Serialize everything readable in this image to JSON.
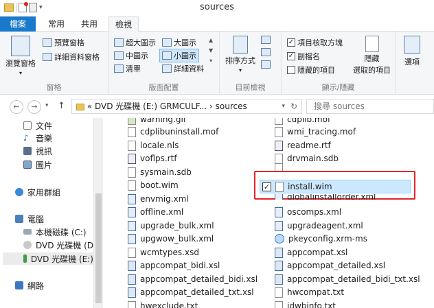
{
  "window": {
    "title": "sources"
  },
  "ribbon_tabs": [
    {
      "label": "檔案"
    },
    {
      "label": "常用"
    },
    {
      "label": "共用"
    },
    {
      "label": "檢視"
    }
  ],
  "ribbon": {
    "panes": {
      "label": "窗格",
      "nav_pane": "瀏覽窗格",
      "preview_pane": "預覽窗格",
      "details_pane": "詳細資料窗格"
    },
    "layout": {
      "label": "版面配置",
      "extra_large": "超大圖示",
      "large": "大圖示",
      "medium": "中圖示",
      "small": "小圖示",
      "list": "清單",
      "details": "詳細資料"
    },
    "current_view": {
      "label": "目前檢視",
      "sort_by": "排序方式"
    },
    "show_hide": {
      "label": "顯示/隱藏",
      "item_checkboxes": "項目核取方塊",
      "file_extensions": "副檔名",
      "hidden_items": "隱藏的項目",
      "hide_selected_line1": "隱藏",
      "hide_selected_line2": "選取的項目"
    },
    "options": {
      "label": "選項"
    }
  },
  "address": {
    "path_prefix": "«",
    "drive": "DVD 光碟機 (E:) GRMCULF...",
    "separator": "›",
    "folder": "sources",
    "search_placeholder": "搜尋 sources"
  },
  "nav": {
    "items": [
      {
        "label": "文件"
      },
      {
        "label": "音樂"
      },
      {
        "label": "視訊"
      },
      {
        "label": "圖片"
      },
      {
        "label": "家用群組"
      },
      {
        "label": "電腦"
      },
      {
        "label": "本機磁碟 (C:)"
      },
      {
        "label": "DVD 光碟機 (D:)"
      },
      {
        "label": "DVD 光碟機 (E:)"
      },
      {
        "label": "網路"
      }
    ]
  },
  "files": {
    "col1": [
      "warning.gif",
      "cdplibuninstall.mof",
      "locale.nls",
      "voflps.rtf",
      "sysmain.sdb",
      "boot.wim",
      "envmig.xml",
      "offline.xml",
      "upgrade_bulk.xml",
      "upgwow_bulk.xml",
      "wcmtypes.xsd",
      "appcompat_bidi.xsl",
      "appcompat_detailed_bidi.xsl",
      "appcompat_detailed_txt.xsl",
      "hwexclude.txt"
    ],
    "col2": [
      "cdplib.mof",
      "wmi_tracing.mof",
      "readme.rtf",
      "drvmain.sdb",
      "",
      "install.wim",
      "globalinstallorder.xml",
      "oscomps.xml",
      "upgradeagent.xml",
      "pkeyconfig.xrm-ms",
      "appcompat.xsl",
      "appcompat_detailed.xsl",
      "appcompat_detailed_bidi_txt.xsl",
      "hwcompat.txt",
      "idwbinfo.txt"
    ],
    "selected": "install.wim"
  }
}
